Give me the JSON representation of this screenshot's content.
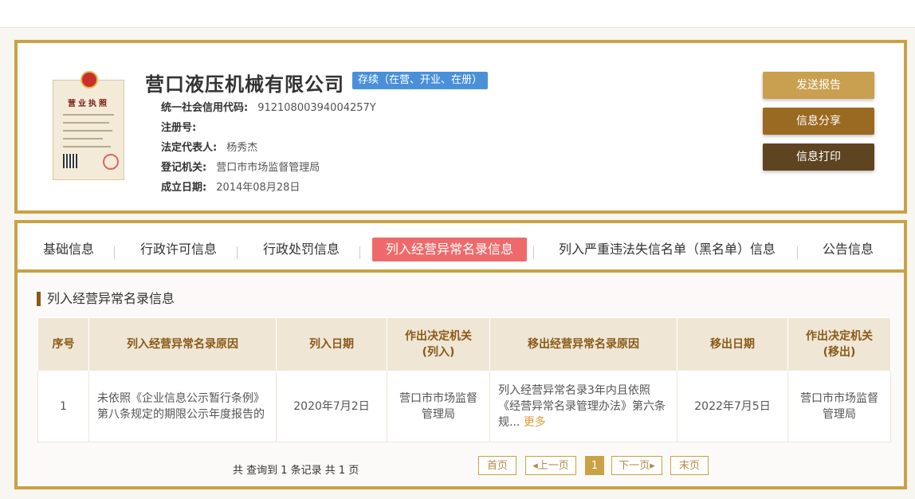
{
  "company": {
    "name": "营口液压机械有限公司",
    "status": "存续（在营、开业、在册）",
    "fields": [
      {
        "label": "统一社会信用代码:",
        "value": "91210800394004257Y"
      },
      {
        "label": "注册号:",
        "value": ""
      },
      {
        "label": "法定代表人:",
        "value": "杨秀杰"
      },
      {
        "label": "登记机关:",
        "value": "营口市市场监督管理局"
      },
      {
        "label": "成立日期:",
        "value": "2014年08月28日"
      }
    ],
    "license_title": "营业执照"
  },
  "actions": {
    "send_report": "发送报告",
    "share": "信息分享",
    "print": "信息打印"
  },
  "colors": {
    "gold": "#c9a245",
    "btn1": "#c9a04f",
    "btn2": "#9b6a22",
    "btn3": "#5e4420",
    "active_tab": "#ee6a6a",
    "status_badge": "#4a90d9"
  },
  "tabs": [
    {
      "label": "基础信息",
      "active": false
    },
    {
      "label": "行政许可信息",
      "active": false
    },
    {
      "label": "行政处罚信息",
      "active": false
    },
    {
      "label": "列入经营异常名录信息",
      "active": true
    },
    {
      "label": "列入严重违法失信名单（黑名单）信息",
      "active": false
    },
    {
      "label": "公告信息",
      "active": false
    }
  ],
  "section": {
    "title": "列入经营异常名录信息"
  },
  "table": {
    "headers": [
      "序号",
      "列入经营异常名录原因",
      "列入日期",
      "作出决定机关\n(列入)",
      "移出经营异常名录原因",
      "移出日期",
      "作出决定机关\n(移出)"
    ],
    "rows": [
      {
        "no": "1",
        "reason": "未依照《企业信息公示暂行条例》第八条规定的期限公示年度报告的",
        "date_in": "2020年7月2日",
        "authority_in": "营口市市场监督管理局",
        "reason_out": "列入经营异常名录3年内且依照《经营异常名录管理办法》第六条规...",
        "more": "更多",
        "date_out": "2022年7月5日",
        "authority_out": "营口市市场监督管理局"
      }
    ]
  },
  "pagination": {
    "summary": "共 查询到 1 条记录 共 1 页",
    "first": "首页",
    "prev": "上一页",
    "current": "1",
    "next": "下一页",
    "last": "末页",
    "prev_arrow": "◂",
    "next_arrow": "▸"
  }
}
